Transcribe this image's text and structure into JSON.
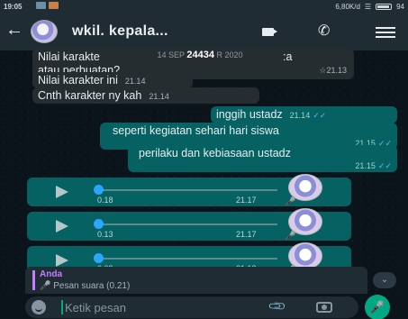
{
  "status_bar": {
    "time": "19:05",
    "network_speed": "6,80K/d",
    "battery": "94"
  },
  "header": {
    "title": "wkil. kepala...",
    "back_icon": "arrow-left-icon",
    "video_icon": "video-call-icon",
    "call_icon": "phone-icon",
    "menu_icon": "menu-icon"
  },
  "date_pill": "14 SEP",
  "overlay_number": "24434",
  "date_pill_suffix": "R 2020",
  "messages": [
    {
      "type": "in",
      "text": "Nilai karakte",
      "text_end": ":a",
      "line2": "atau perbuatan?",
      "time": "21.13"
    },
    {
      "type": "in",
      "text": "Nilai karakter ini",
      "time": "21.14"
    },
    {
      "type": "in",
      "text": "Cnth karakter ny kah",
      "time": "21.14"
    },
    {
      "type": "out",
      "text": "inggih ustadz",
      "time": "21.14"
    },
    {
      "type": "out",
      "text": "seperti kegiatan sehari hari siswa",
      "time": "21.15"
    },
    {
      "type": "out",
      "text": "perilaku dan kebiasaan ustadz",
      "time": "21.15"
    }
  ],
  "voice_notes": [
    {
      "duration": "0.18",
      "time": "21.17"
    },
    {
      "duration": "0.13",
      "time": "21.17"
    },
    {
      "duration": "0.09",
      "time": "21.18"
    }
  ],
  "reply_preview": {
    "sender": "Anda",
    "text": "Pesan suara (0.21)"
  },
  "input": {
    "placeholder": "Ketik pesan"
  },
  "colors": {
    "outgoing_bubble": "#056162",
    "incoming_bubble": "#262d31",
    "accent": "#00a884",
    "read_tick": "#53bdeb"
  }
}
